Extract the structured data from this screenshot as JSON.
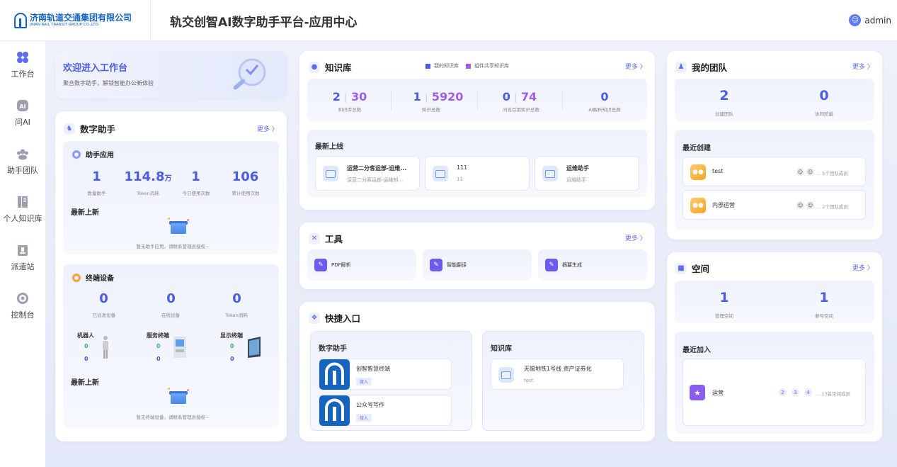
{
  "header": {
    "logo_cn": "济南轨道交通集团有限公司",
    "logo_en": "JINAN RAIL TRANSIT GROUP CO.,LTD.",
    "title": "轨交创智AI数字助手平台-应用中心",
    "user": "admin"
  },
  "sidebar": {
    "items": [
      {
        "label": "工作台",
        "icon": "grid-icon"
      },
      {
        "label": "问AI",
        "icon": "ai-icon"
      },
      {
        "label": "助手团队",
        "icon": "team-icon"
      },
      {
        "label": "个人知识库",
        "icon": "book-icon"
      },
      {
        "label": "派遣站",
        "icon": "dispatch-icon"
      },
      {
        "label": "控制台",
        "icon": "console-icon"
      }
    ]
  },
  "welcome": {
    "title": "欢迎进入工作台",
    "subtitle": "聚合数字助手，解锁智能办公新体验"
  },
  "assistant": {
    "title": "数字助手",
    "more": "更多 〉",
    "apps_title": "助手应用",
    "stats": [
      {
        "value": "1",
        "unit": "",
        "label": "数量助手"
      },
      {
        "value": "114.8",
        "unit": "万",
        "label": "Token消耗"
      },
      {
        "value": "1",
        "unit": "",
        "label": "今日使用次数"
      },
      {
        "value": "106",
        "unit": "",
        "label": "累计使用次数"
      }
    ],
    "latest_title": "最新上新",
    "empty_text": "暂无助手应用，请联系管理员授权~"
  },
  "devices": {
    "title": "终端设备",
    "stats": [
      {
        "value": "0",
        "label": "已派发设备"
      },
      {
        "value": "0",
        "label": "在线设备"
      },
      {
        "value": "0",
        "label": "Token消耗"
      }
    ],
    "types": [
      {
        "name": "机器人",
        "a": "0",
        "b": "0"
      },
      {
        "name": "服务终端",
        "a": "0",
        "b": "0"
      },
      {
        "name": "显示终端",
        "a": "0",
        "b": "0"
      }
    ],
    "latest_title": "最新上新",
    "empty_text": "暂无终端设备，请联系管理员授权~"
  },
  "knowledge": {
    "title": "知识库",
    "legend": [
      "我的知识库",
      "组件共享知识库"
    ],
    "more": "更多 〉",
    "stats": [
      {
        "a": "2",
        "b": "30",
        "label": "知识库总数"
      },
      {
        "a": "1",
        "b": "5920",
        "label": "知识总数"
      },
      {
        "a": "0",
        "b": "74",
        "label": "问答引用知识总数"
      },
      {
        "a": "0",
        "b": "",
        "label": "AI解析知识总数"
      }
    ],
    "latest_title": "最新上线",
    "latest": [
      {
        "name": "运营二分客运部-运维...",
        "desc": "运营二分客运部-运维知..."
      },
      {
        "name": "111",
        "desc": "11"
      },
      {
        "name": "运维助手",
        "desc": "运维助手"
      }
    ]
  },
  "tools": {
    "title": "工具",
    "more": "更多 〉",
    "items": [
      "PDF解析",
      "智能翻译",
      "摘要生成"
    ]
  },
  "shortcuts": {
    "title": "快捷入口",
    "assistant_col": "数字助手",
    "knowledge_col": "知识库",
    "assistants": [
      {
        "name": "创智智慧终端",
        "tag": "接入"
      },
      {
        "name": "公众号写作",
        "tag": "接入"
      }
    ],
    "kb": {
      "name": "无锡地铁1号线 资产证券化",
      "desc": "test"
    }
  },
  "team": {
    "title": "我的团队",
    "more": "更多 〉",
    "stats": [
      {
        "value": "2",
        "label": "创建团队"
      },
      {
        "value": "0",
        "label": "协同纺量"
      }
    ],
    "recent_title": "最近创建",
    "teams": [
      {
        "name": "test",
        "members": "... 5个团队成员"
      },
      {
        "name": "内部运营",
        "members": "... 2个团队成员"
      }
    ]
  },
  "space": {
    "title": "空间",
    "more": "更多 〉",
    "stats": [
      {
        "value": "1",
        "label": "管理空间"
      },
      {
        "value": "1",
        "label": "参与空间"
      }
    ],
    "recent_title": "最近加入",
    "item": {
      "name": "运营",
      "avatars": [
        "2",
        "3",
        "4"
      ],
      "members": "... 13名空间成员"
    }
  },
  "colors": {
    "accent": "#5b6ef5",
    "purple": "#a25ce6",
    "number": "#4a5be8"
  }
}
